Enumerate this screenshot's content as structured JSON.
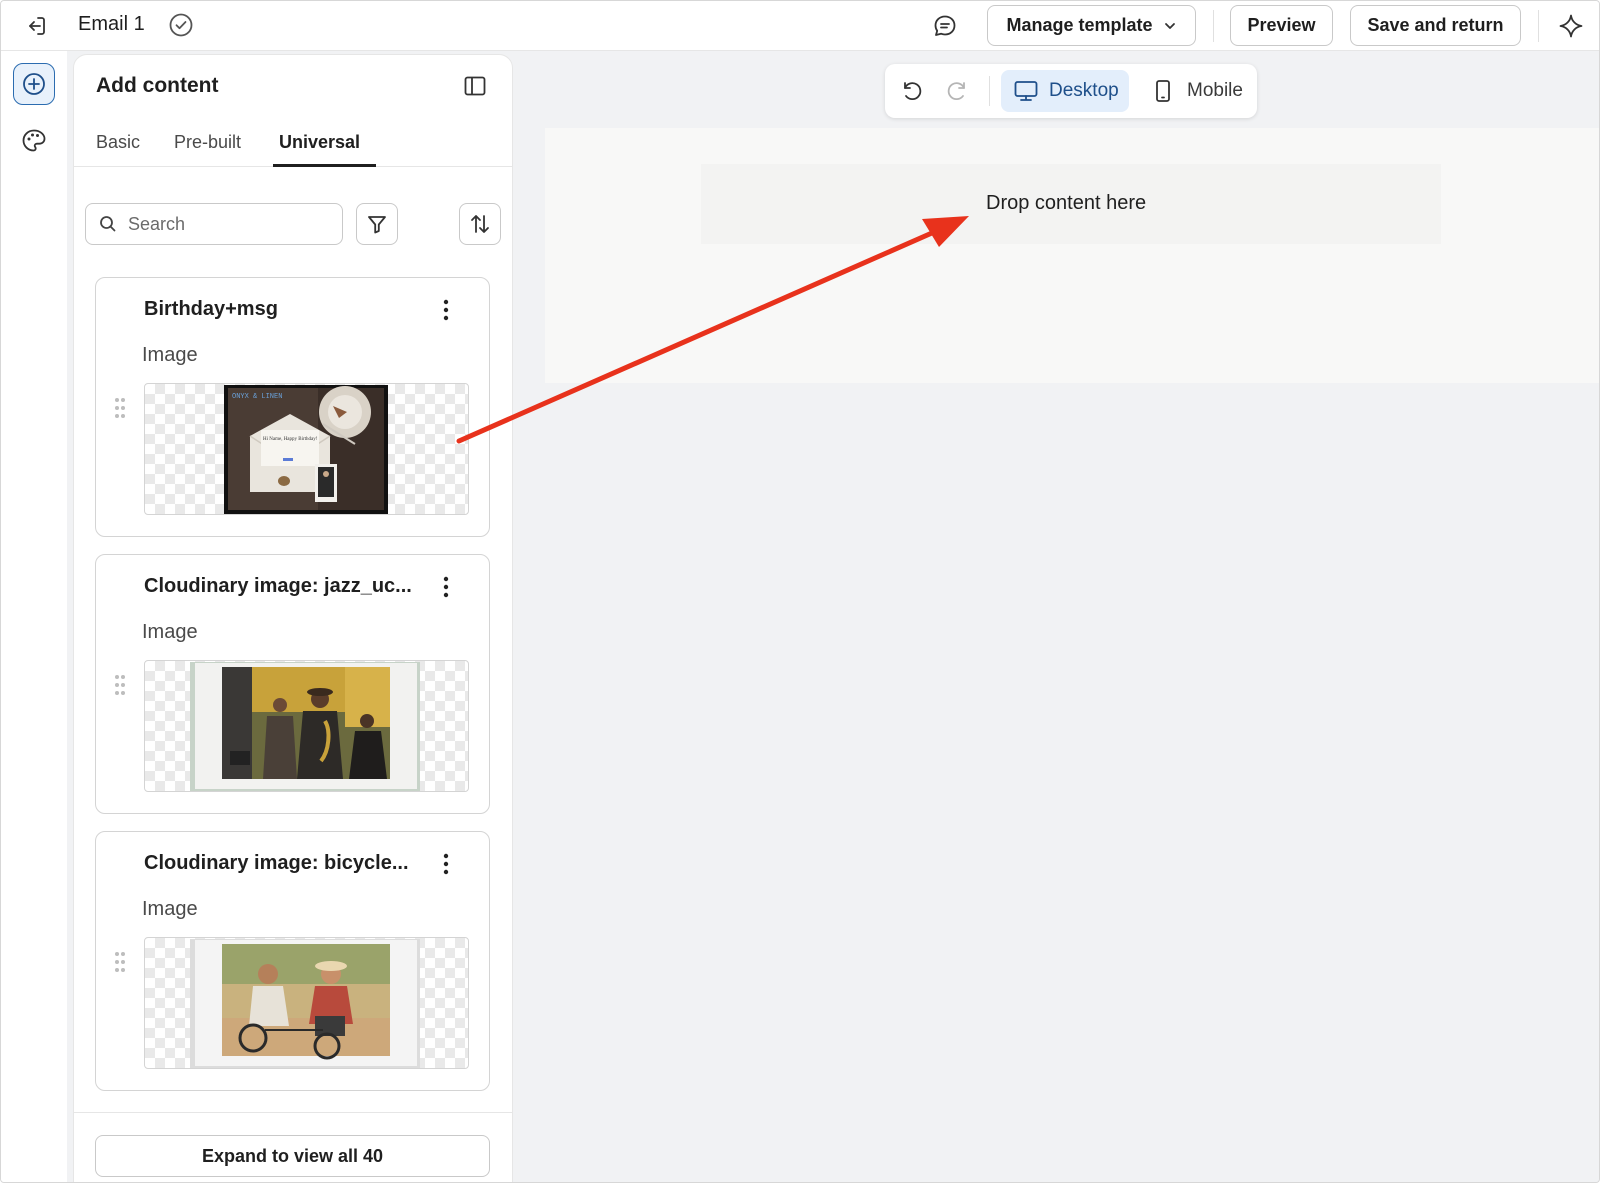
{
  "header": {
    "title": "Email 1",
    "manage_template_label": "Manage template",
    "preview_label": "Preview",
    "save_label": "Save and return"
  },
  "panel": {
    "title": "Add content",
    "tabs": [
      {
        "label": "Basic",
        "active": false
      },
      {
        "label": "Pre-built",
        "active": false
      },
      {
        "label": "Universal",
        "active": true
      }
    ],
    "search": {
      "placeholder": "Search",
      "value": ""
    },
    "items": [
      {
        "title": "Birthday+msg",
        "type": "Image"
      },
      {
        "title": "Cloudinary image: jazz_uc...",
        "type": "Image"
      },
      {
        "title": "Cloudinary image: bicycle...",
        "type": "Image"
      }
    ],
    "expand_label": "Expand to view all 40",
    "birthday_thumb": {
      "brand": "ONYX & LINEN",
      "greeting": "Hi Name, Happy Birthday!"
    }
  },
  "canvas": {
    "toolbar": {
      "desktop_label": "Desktop",
      "mobile_label": "Mobile",
      "active_view": "Desktop"
    },
    "dropzone_label": "Drop content here"
  },
  "colors": {
    "accent": "#2b6cb0",
    "active_segment": "#e3eefb",
    "annotation_arrow": "#e8321c"
  },
  "icons": [
    "exit-icon",
    "check-circle-icon",
    "comment-icon",
    "chevron-down-icon",
    "sparkle-icon",
    "add-circle-icon",
    "palette-icon",
    "panel-toggle-icon",
    "search-icon",
    "filter-icon",
    "sort-icon",
    "more-vertical-icon",
    "drag-handle-icon",
    "undo-icon",
    "redo-icon",
    "desktop-icon",
    "mobile-icon"
  ]
}
